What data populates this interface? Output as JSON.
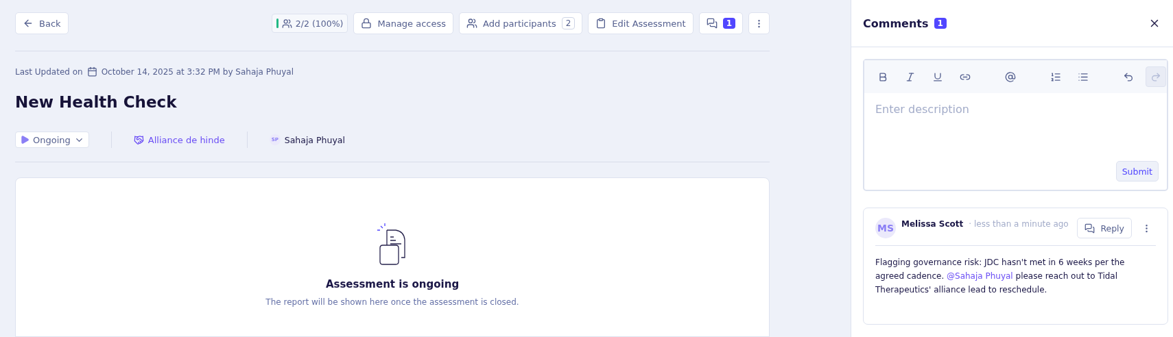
{
  "back_button": {
    "label": "Back"
  },
  "toolbar": {
    "progress": {
      "label": "2/2 (100%)",
      "level": 1
    },
    "buttons": [
      {
        "kind": "lock",
        "label": "Manage access"
      },
      {
        "kind": "people",
        "label": "Add participants",
        "count": "2"
      },
      {
        "kind": "clipboard",
        "label": "Edit Assessment"
      }
    ],
    "comments_button": {
      "count": "1"
    }
  },
  "last_updated": {
    "prefix": "Last Updated on",
    "text": "October 14, 2025 at 3:32 PM by Sahaja Phuyal"
  },
  "title": "New Health Check",
  "meta": {
    "status": "Ongoing",
    "alliance": "Alliance de hinde",
    "owner_initials": "SP",
    "owner": "Sahaja Phuyal"
  },
  "report": {
    "heading": "Assessment is ongoing",
    "message": "The report will be shown here once the assessment is closed."
  },
  "comments_panel": {
    "title": "Comments",
    "count": "1",
    "editor": {
      "tool_groups": [
        [
          {
            "kind": "bold",
            "disabled": false
          },
          {
            "kind": "italic",
            "disabled": false
          },
          {
            "kind": "underline",
            "disabled": false
          },
          {
            "kind": "link",
            "disabled": false
          }
        ],
        [
          {
            "kind": "mention",
            "disabled": false
          }
        ],
        [
          {
            "kind": "ordered",
            "disabled": false
          },
          {
            "kind": "bullets",
            "disabled": false
          }
        ],
        [
          {
            "kind": "undo",
            "disabled": false
          },
          {
            "kind": "redo",
            "disabled": true
          }
        ]
      ],
      "placeholder": "Enter description",
      "submit": "Submit"
    },
    "comments": [
      {
        "initials": "MS",
        "author": "Melissa Scott",
        "time": "· less than a minute ago",
        "reply": "Reply",
        "text_before": "Flagging governance risk: JDC hasn't met in 6 weeks per the agreed cadence.",
        "mention": "@Sahaja Phuyal",
        "text_after": "please reach out to Tidal Therapeutics' alliance lead to reschedule."
      }
    ]
  }
}
